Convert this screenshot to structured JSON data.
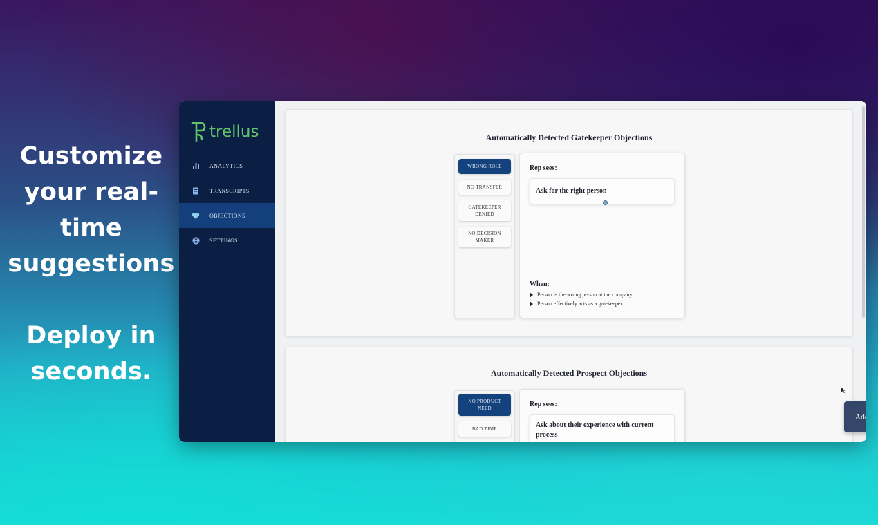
{
  "promo": {
    "line1": "Customize your real-time suggestions",
    "line2": "Deploy in seconds."
  },
  "brand": {
    "name": "trellus",
    "color": "#63c46b"
  },
  "sidebar": {
    "items": [
      {
        "label": "ANALYTICS",
        "icon": "bar-chart-icon",
        "active": false
      },
      {
        "label": "TRANSCRIPTS",
        "icon": "document-icon",
        "active": false
      },
      {
        "label": "OBJECTIONS",
        "icon": "heart-hand-icon",
        "active": true
      },
      {
        "label": "SETTINGS",
        "icon": "globe-icon",
        "active": false
      }
    ]
  },
  "gatekeeper": {
    "title": "Automatically Detected Gatekeeper Objections",
    "tabs": [
      {
        "label": "WRONG ROLE",
        "active": true
      },
      {
        "label": "NO TRANSFER",
        "active": false
      },
      {
        "label": "GATEKEEPER DENIED",
        "active": false
      },
      {
        "label": "NO DECISION MAKER",
        "active": false
      }
    ],
    "rep_sees_label": "Rep sees:",
    "suggestion": "Ask for the right person",
    "when_label": "When:",
    "conditions": [
      "Person is the wrong person at the company",
      "Person effectively acts as a gatekeeper"
    ]
  },
  "prospect": {
    "title": "Automatically Detected Prospect Objections",
    "tabs": [
      {
        "label": "NO PRODUCT NEED",
        "active": true
      },
      {
        "label": "BAD TIME",
        "active": false
      }
    ],
    "rep_sees_label": "Rep sees:",
    "suggestion": "Ask about their experience with current process"
  },
  "add_trigger_label": "Add custom trigger (+)",
  "colors": {
    "sidebar_bg": "#0b1f45",
    "active_nav": "#143f7d",
    "active_tab": "#14427c",
    "button": "#34476a"
  }
}
